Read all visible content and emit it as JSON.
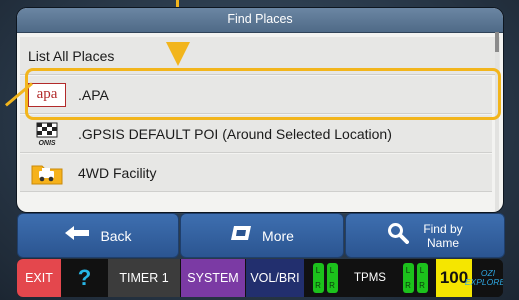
{
  "panel": {
    "title": "Find Places",
    "list_all": "List All Places",
    "items": [
      {
        "label": ".APA",
        "icon": "apa-logo-icon",
        "icon_text": "apa"
      },
      {
        "label": ".GPSIS DEFAULT POI (Around Selected Location)",
        "icon": "checkered-flag-icon",
        "icon_text": "ONIS"
      },
      {
        "label": "4WD Facility",
        "icon": "4wd-vehicle-folder-icon"
      }
    ]
  },
  "nav": {
    "back": "Back",
    "more": "More",
    "find_by_name_1": "Find by",
    "find_by_name_2": "Name"
  },
  "status": {
    "exit": "EXIT",
    "help": "?",
    "timer": "TIMER 1",
    "system": "SYSTEM",
    "volbri": "VOL/BRI",
    "tpms": "TPMS",
    "speed": "100",
    "ozi_1": "OZI",
    "ozi_2": "EXPLORER",
    "lr_l": "L",
    "lr_r": "R"
  },
  "colors": {
    "highlight": "#f2b51c",
    "nav_blue": "#2b5591",
    "exit_red": "#e4474d",
    "help_cyan": "#27b6e6",
    "system_purple": "#7b3aa4",
    "speed_yellow": "#f5e600"
  }
}
